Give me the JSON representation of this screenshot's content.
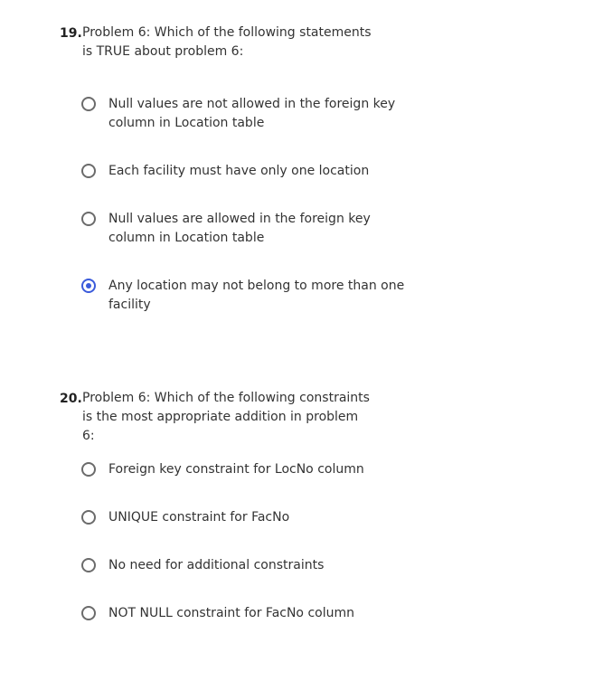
{
  "questions": [
    {
      "number": "19.",
      "text": "Problem 6: Which of the following statements is TRUE about problem 6:",
      "options": [
        {
          "label": "Null values are not allowed in the foreign key column in Location table",
          "selected": false
        },
        {
          "label": "Each facility must have only one location",
          "selected": false
        },
        {
          "label": "Null values are allowed in the foreign key column in Location table",
          "selected": false
        },
        {
          "label": "Any location may not belong to more than one facility",
          "selected": true
        }
      ]
    },
    {
      "number": "20.",
      "text": "Problem 6: Which of the following constraints is the most appropriate addition in problem 6:",
      "options": [
        {
          "label": "Foreign key constraint for LocNo column",
          "selected": false
        },
        {
          "label": "UNIQUE constraint for FacNo",
          "selected": false
        },
        {
          "label": "No need for additional constraints",
          "selected": false
        },
        {
          "label": "NOT NULL constraint for FacNo column",
          "selected": false
        }
      ]
    }
  ],
  "colors": {
    "radio_selected": "#3b5bdb",
    "radio_border": "#6b6b6b",
    "text": "#333333"
  }
}
